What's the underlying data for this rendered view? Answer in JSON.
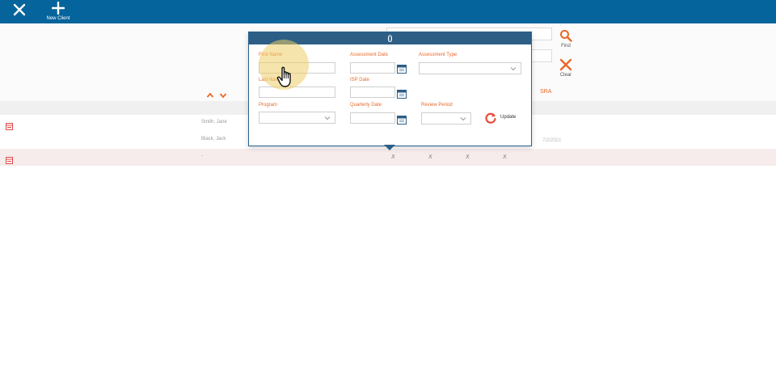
{
  "toolbar": {
    "close_icon": "close-icon",
    "new_client_label": "New Client"
  },
  "filter": {
    "find_label": "Find",
    "clear_label": "Clear"
  },
  "grid": {
    "sra_header": "SRA",
    "rows": [
      {
        "name": "Smith, Jane",
        "date": ""
      },
      {
        "name": "Black, Jack",
        "date": "7/2/2021"
      },
      {
        "name": "-",
        "marks": [
          "X",
          "X",
          "X",
          "X"
        ]
      }
    ]
  },
  "popup": {
    "title": "()",
    "first_name_label": "First Name",
    "last_name_label": "Last Name",
    "assessment_date_label": "Assessment Date",
    "assessment_type_label": "Assessment Type",
    "isp_date_label": "ISP Date",
    "program_label": "Program",
    "quarterly_date_label": "Quarterly Date",
    "review_period_label": "Review Period",
    "update_label": "Update"
  },
  "colors": {
    "topbar": "#04649b",
    "popup_title": "#2d5e86",
    "accent_orange": "#e8692a"
  }
}
